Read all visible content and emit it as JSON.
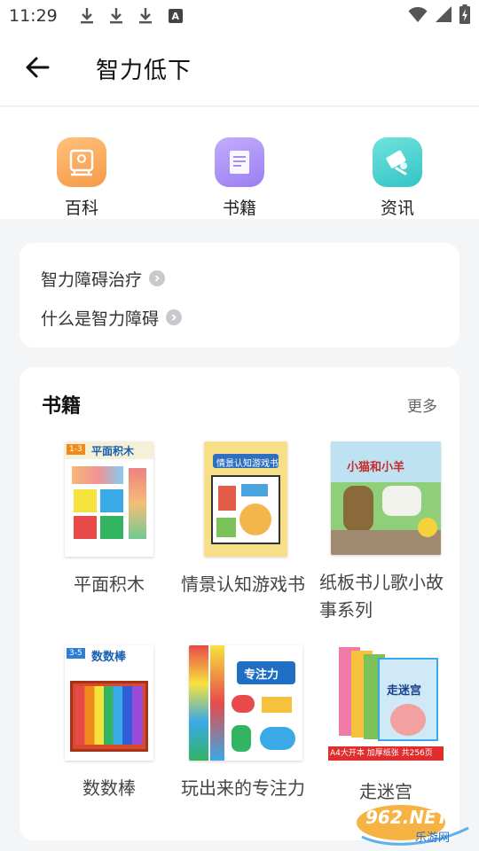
{
  "status_bar": {
    "time": "11:29",
    "icons": [
      "download-icon",
      "download-icon",
      "download-icon",
      "a-badge-icon",
      "wifi-icon",
      "signal-icon",
      "battery-charging-icon"
    ],
    "a_badge": "A"
  },
  "appbar": {
    "title": "智力低下"
  },
  "categories": [
    {
      "label": "百科",
      "icon": "encyclopedia-icon",
      "color": "#f5a55b"
    },
    {
      "label": "书籍",
      "icon": "book-icon",
      "color": "#a98ef5"
    },
    {
      "label": "资讯",
      "icon": "news-icon",
      "color": "#4fd0cf"
    }
  ],
  "related_links": [
    {
      "label": "智力障碍治疗"
    },
    {
      "label": "什么是智力障碍"
    }
  ],
  "books_section": {
    "title": "书籍",
    "more_label": "更多",
    "items": [
      {
        "title": "平面积木",
        "cover_text": "平面积木",
        "cover_badge": "1-3"
      },
      {
        "title": "情景认知游戏书",
        "cover_text": "情景认知游戏书"
      },
      {
        "title": "纸板书儿歌小故事系列",
        "cover_text": "小猫和小羊"
      },
      {
        "title": "数数棒",
        "cover_text": "数数棒",
        "cover_badge": "3-5"
      },
      {
        "title": "玩出来的专注力",
        "cover_text": "专注力"
      },
      {
        "title": "走迷宫",
        "cover_text": "走迷宫",
        "cover_strip": "A4大开本 加厚纸张 共256页"
      }
    ]
  },
  "watermark": {
    "main": "962.NET",
    "sub": "乐游网"
  }
}
